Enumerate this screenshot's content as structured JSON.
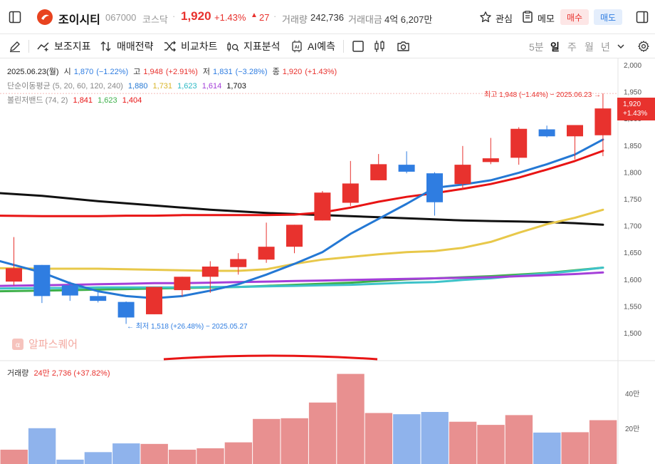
{
  "stock": {
    "name": "조이시티",
    "code": "067000",
    "market": "코스닥",
    "price": "1,920",
    "change_pct": "+1.43%",
    "change_amt": "27",
    "volume_label": "거래량",
    "volume": "242,736",
    "amount_label": "거래대금",
    "amount": "4억 6,207만"
  },
  "actions": {
    "watch": "관심",
    "memo": "메모",
    "buy": "매수",
    "sell": "매도"
  },
  "toolbar": {
    "indicators": "보조지표",
    "strategy": "매매전략",
    "compare": "비교차트",
    "analysis": "지표분석",
    "ai": "AI예측",
    "periods": [
      "5분",
      "일",
      "주",
      "월",
      "년"
    ],
    "active_period": "일"
  },
  "legend": {
    "ohlc": {
      "date": "2025.06.23(월)",
      "open_label": "시",
      "open": "1,870",
      "open_pct": "(−1.22%)",
      "high_label": "고",
      "high": "1,948",
      "high_pct": "(+2.91%)",
      "low_label": "저",
      "low": "1,831",
      "low_pct": "(−3.28%)",
      "close_label": "종",
      "close": "1,920",
      "close_pct": "(+1.43%)"
    },
    "ma": {
      "label": "단순이동평균 (5, 20, 60, 120, 240)",
      "values": [
        "1,880",
        "1,731",
        "1,623",
        "1,614",
        "1,703"
      ]
    },
    "bb": {
      "label": "볼린저밴드 (74, 2)",
      "values": [
        "1,841",
        "1,623",
        "1,404"
      ]
    },
    "volume": {
      "label": "거래량",
      "value": "24만 2,736 (+37.82%)"
    }
  },
  "annotations": {
    "high": "최고 1,948 (−1.44%) − 2025.06.23 →",
    "low": "← 최저 1,518 (+26.48%) − 2025.05.27",
    "price_tag": "1,920",
    "price_tag_pct": "+1.43%",
    "watermark": "알파스퀘어"
  },
  "colors": {
    "up": "#e8322e",
    "down": "#2f7de1",
    "ma5": "#2478d4",
    "ma20": "#e8c84a",
    "ma60": "#3ec2c9",
    "ma120": "#a43fd9",
    "ma240": "#111111",
    "bb_upper": "#e81414",
    "bb_mid": "#3db04a",
    "vol_up": "#e89090",
    "vol_down": "#8fb3ec"
  },
  "chart_data": {
    "type": "candlestick",
    "y_axis_ticks": [
      "2,000",
      "1,950",
      "1,900",
      "1,850",
      "1,800",
      "1,750",
      "1,700",
      "1,650",
      "1,600",
      "1,550",
      "1,500"
    ],
    "ylim": [
      1470,
      2010
    ],
    "candles": [
      {
        "o": 1597,
        "h": 1680,
        "l": 1590,
        "c": 1622
      },
      {
        "o": 1628,
        "h": 1628,
        "l": 1557,
        "c": 1570
      },
      {
        "o": 1590,
        "h": 1597,
        "l": 1561,
        "c": 1571
      },
      {
        "o": 1570,
        "h": 1580,
        "l": 1558,
        "c": 1561
      },
      {
        "o": 1559,
        "h": 1560,
        "l": 1518,
        "c": 1530
      },
      {
        "o": 1536,
        "h": 1587,
        "l": 1536,
        "c": 1587
      },
      {
        "o": 1581,
        "h": 1606,
        "l": 1569,
        "c": 1606
      },
      {
        "o": 1606,
        "h": 1635,
        "l": 1576,
        "c": 1625
      },
      {
        "o": 1624,
        "h": 1650,
        "l": 1610,
        "c": 1639
      },
      {
        "o": 1638,
        "h": 1707,
        "l": 1632,
        "c": 1662
      },
      {
        "o": 1662,
        "h": 1703,
        "l": 1650,
        "c": 1703
      },
      {
        "o": 1711,
        "h": 1766,
        "l": 1711,
        "c": 1763
      },
      {
        "o": 1744,
        "h": 1822,
        "l": 1738,
        "c": 1780
      },
      {
        "o": 1786,
        "h": 1835,
        "l": 1786,
        "c": 1816
      },
      {
        "o": 1815,
        "h": 1840,
        "l": 1799,
        "c": 1802
      },
      {
        "o": 1799,
        "h": 1801,
        "l": 1720,
        "c": 1745
      },
      {
        "o": 1779,
        "h": 1850,
        "l": 1769,
        "c": 1815
      },
      {
        "o": 1820,
        "h": 1865,
        "l": 1816,
        "c": 1827
      },
      {
        "o": 1828,
        "h": 1885,
        "l": 1815,
        "c": 1882
      },
      {
        "o": 1881,
        "h": 1888,
        "l": 1866,
        "c": 1868
      },
      {
        "o": 1868,
        "h": 1889,
        "l": 1825,
        "c": 1889
      },
      {
        "o": 1870,
        "h": 1948,
        "l": 1831,
        "c": 1920
      }
    ],
    "ma5": [
      1635,
      1614,
      1594,
      1579,
      1570,
      1566,
      1570,
      1580,
      1592,
      1610,
      1630,
      1652,
      1686,
      1714,
      1742,
      1772,
      1778,
      1786,
      1800,
      1816,
      1834,
      1862
    ],
    "ma20": [
      1622,
      1621,
      1621,
      1621,
      1620,
      1619,
      1618,
      1617,
      1617,
      1620,
      1630,
      1638,
      1643,
      1648,
      1652,
      1654,
      1660,
      1671,
      1688,
      1704,
      1716,
      1731
    ],
    "ma60": [
      1584,
      1585,
      1585,
      1586,
      1586,
      1586,
      1586,
      1587,
      1587,
      1588,
      1589,
      1590,
      1591,
      1593,
      1595,
      1596,
      1600,
      1603,
      1608,
      1612,
      1617,
      1623
    ],
    "ma120": [
      1589,
      1590,
      1591,
      1592,
      1593,
      1594,
      1594,
      1595,
      1596,
      1597,
      1598,
      1599,
      1600,
      1601,
      1602,
      1603,
      1604,
      1605,
      1607,
      1609,
      1611,
      1614
    ],
    "ma240": [
      1762,
      1757,
      1752,
      1747,
      1743,
      1739,
      1735,
      1731,
      1728,
      1725,
      1723,
      1721,
      1719,
      1717,
      1715,
      1713,
      1711,
      1710,
      1709,
      1708,
      1706,
      1703
    ],
    "bb_upper": [
      1720,
      1719,
      1719,
      1719,
      1720,
      1720,
      1721,
      1721,
      1721,
      1721,
      1722,
      1726,
      1735,
      1746,
      1755,
      1762,
      1770,
      1779,
      1791,
      1806,
      1822,
      1841
    ],
    "bb_mid": [
      1579,
      1580,
      1581,
      1582,
      1583,
      1584,
      1585,
      1586,
      1587,
      1589,
      1591,
      1593,
      1595,
      1598,
      1601,
      1603,
      1605,
      1607,
      1610,
      1613,
      1618,
      1623
    ],
    "volume": {
      "y_axis_ticks": [
        "40만",
        "20만"
      ],
      "values": [
        8.2,
        20.5,
        2.5,
        6.8,
        11.8,
        11.5,
        8.2,
        9.0,
        12.4,
        25.8,
        26.2,
        35.2,
        51.6,
        29.2,
        28.5,
        29.8,
        24.2,
        22.4,
        28.0,
        18.0,
        18.2,
        25.1
      ]
    }
  }
}
